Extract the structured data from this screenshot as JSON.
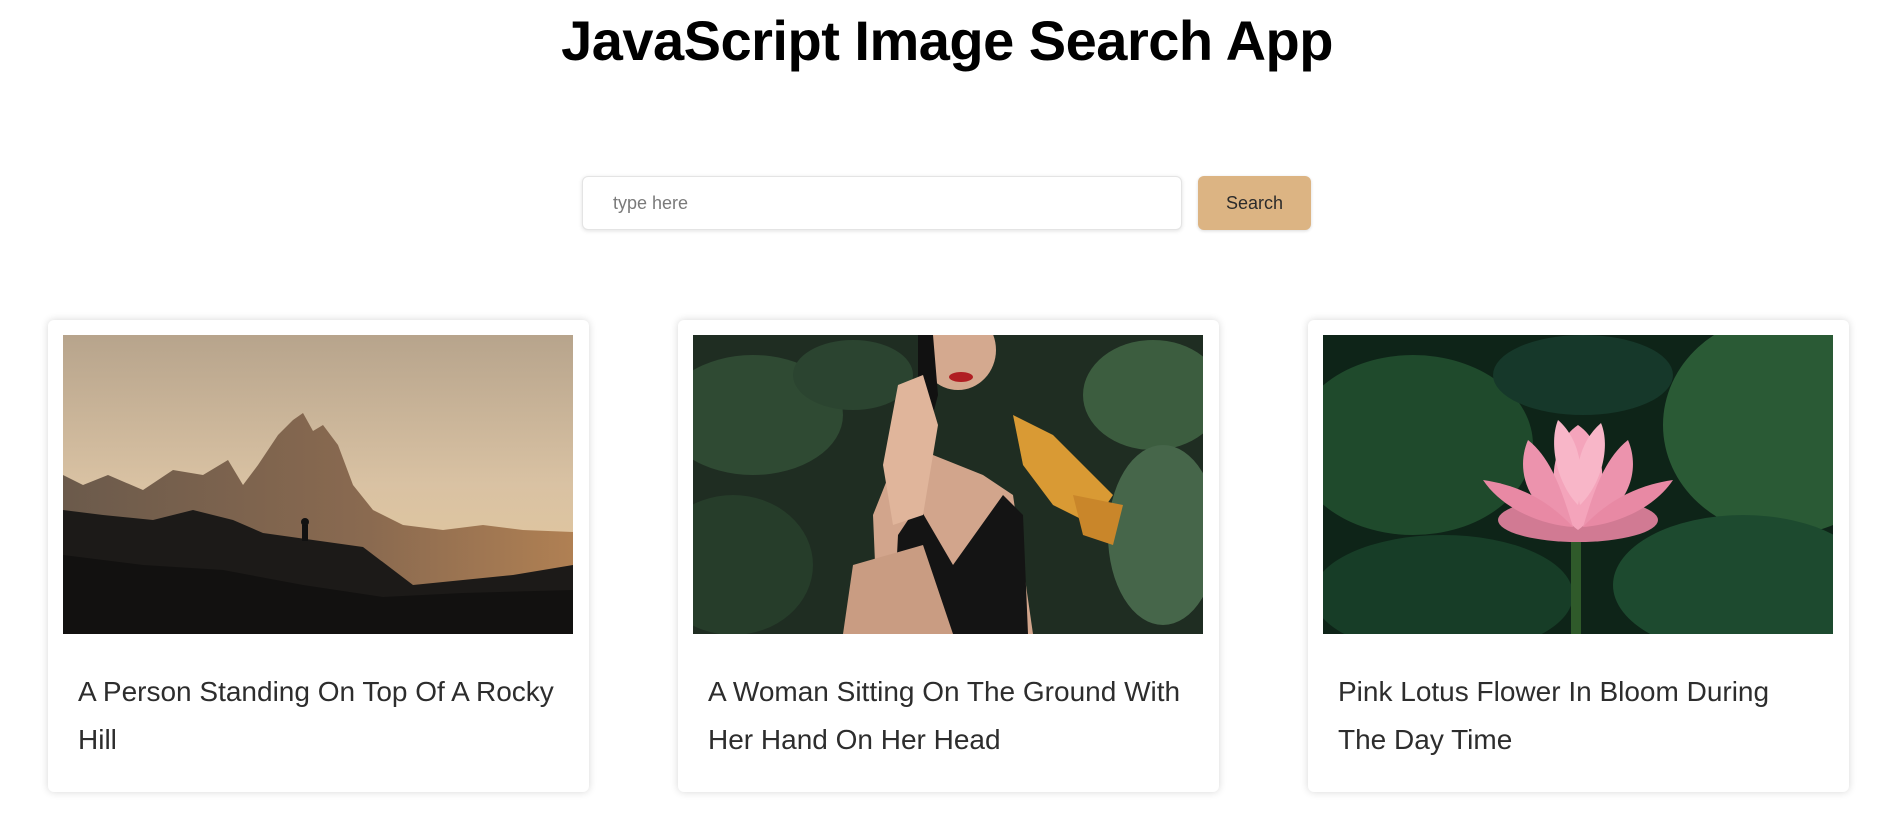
{
  "header": {
    "title": "JavaScript Image Search App"
  },
  "search": {
    "placeholder": "type here",
    "value": "",
    "button_label": "Search"
  },
  "accent_color": "#dcb483",
  "results": [
    {
      "title": "A Person Standing On Top Of A Rocky Hill"
    },
    {
      "title": "A Woman Sitting On The Ground With Her Hand On Her Head"
    },
    {
      "title": "Pink Lotus Flower In Bloom During The Day Time"
    }
  ]
}
